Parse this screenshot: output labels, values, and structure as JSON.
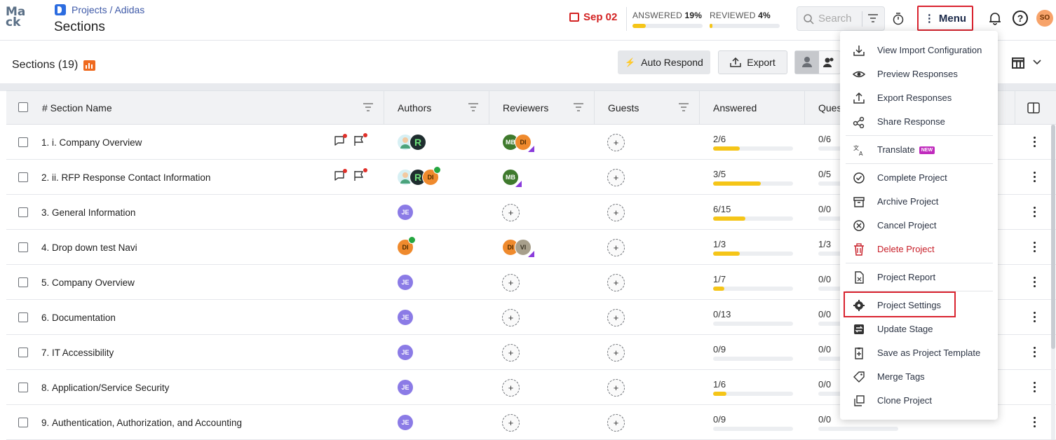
{
  "header": {
    "logo_line1": "Ma",
    "logo_line2": "ck",
    "breadcrumb": "Projects / Adidas",
    "page_title": "Sections",
    "due_date": "Sep 02",
    "answered_label": "ANSWERED",
    "answered_pct": "19%",
    "answered_value": 19,
    "reviewed_label": "REVIEWED",
    "reviewed_pct": "4%",
    "reviewed_value": 4,
    "search_placeholder": "Search",
    "menu_label": "Menu",
    "user_initials": "SO"
  },
  "toolbar": {
    "title": "Sections (19)",
    "auto_respond": "Auto Respond",
    "export": "Export"
  },
  "columns": [
    "# Section Name",
    "Authors",
    "Reviewers",
    "Guests",
    "Answered",
    "Ques"
  ],
  "rows": [
    {
      "num": "1.",
      "name": "i. Company Overview",
      "answered": "2/6",
      "answered_frac": 0.333,
      "ques": "0/6",
      "flags": true
    },
    {
      "num": "2.",
      "name": "ii. RFP Response Contact Information",
      "answered": "3/5",
      "answered_frac": 0.6,
      "ques": "0/5",
      "flags": true
    },
    {
      "num": "3.",
      "name": "General Information",
      "answered": "6/15",
      "answered_frac": 0.4,
      "ques": "0/0",
      "flags": false
    },
    {
      "num": "4.",
      "name": "Drop down test Navi",
      "answered": "1/3",
      "answered_frac": 0.333,
      "ques": "1/3",
      "flags": false
    },
    {
      "num": "5.",
      "name": "Company Overview",
      "answered": "1/7",
      "answered_frac": 0.143,
      "ques": "0/0",
      "flags": false
    },
    {
      "num": "6.",
      "name": "Documentation",
      "answered": "0/13",
      "answered_frac": 0,
      "ques": "0/0",
      "flags": false
    },
    {
      "num": "7.",
      "name": "IT Accessibility",
      "answered": "0/9",
      "answered_frac": 0,
      "ques": "0/0",
      "flags": false
    },
    {
      "num": "8.",
      "name": "Application/Service Security",
      "answered": "1/6",
      "answered_frac": 0.167,
      "ques": "0/0",
      "flags": false
    },
    {
      "num": "9.",
      "name": "Authentication, Authorization, and Accounting",
      "answered": "0/9",
      "answered_frac": 0,
      "ques": "0/0",
      "flags": false
    }
  ],
  "avatars": {
    "je": "JE",
    "mb": "MB",
    "di": "DI",
    "vi": "VI",
    "plus": "+"
  },
  "menu": {
    "items": [
      {
        "label": "View Import Configuration",
        "icon": "download-icon"
      },
      {
        "label": "Preview Responses",
        "icon": "eye-icon"
      },
      {
        "label": "Export Responses",
        "icon": "upload-icon"
      },
      {
        "label": "Share Response",
        "icon": "share-icon"
      },
      {
        "label": "Translate",
        "icon": "translate-icon",
        "badge": "NEW"
      },
      {
        "label": "Complete Project",
        "icon": "check-circle-icon"
      },
      {
        "label": "Archive Project",
        "icon": "archive-icon"
      },
      {
        "label": "Cancel Project",
        "icon": "cancel-circle-icon"
      },
      {
        "label": "Delete Project",
        "icon": "trash-icon"
      },
      {
        "label": "Project Report",
        "icon": "report-icon"
      },
      {
        "label": "Project Settings",
        "icon": "gear-icon"
      },
      {
        "label": "Update Stage",
        "icon": "stage-icon"
      },
      {
        "label": "Save as Project Template",
        "icon": "template-icon"
      },
      {
        "label": "Merge Tags",
        "icon": "tag-icon"
      },
      {
        "label": "Clone Project",
        "icon": "clone-icon"
      }
    ]
  },
  "colors": {
    "accent_red": "#d9232f",
    "progress": "#f5c518",
    "brand_blue": "#2c6ce0"
  }
}
